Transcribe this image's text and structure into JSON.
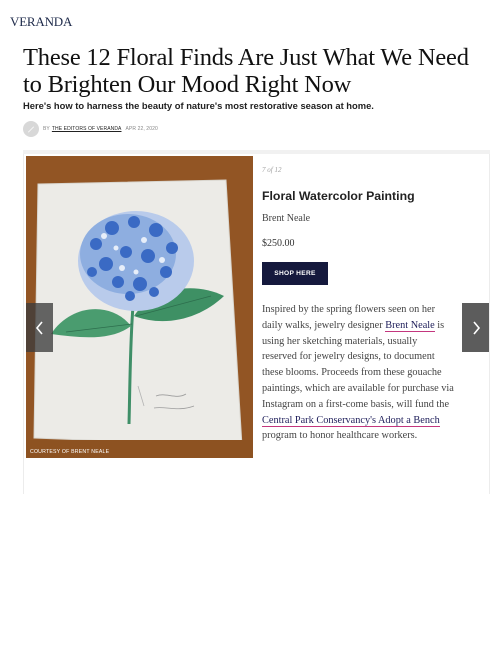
{
  "site": {
    "logo": "VERANDA"
  },
  "article": {
    "headline": "These 12 Floral Finds Are Just What We Need to Brighten Our Mood Right Now",
    "dek": "Here's how to harness the beauty of nature's most restorative season at home.",
    "byline_prefix": "BY",
    "author": "THE EDITORS OF VERANDA",
    "date": "APR 22, 2020"
  },
  "slide": {
    "counter": "7 of 12",
    "title": "Floral Watercolor Painting",
    "brand": "Brent Neale",
    "price": "$250.00",
    "cta": "SHOP HERE",
    "credit": "COURTESY OF BRENT NEALE",
    "desc_1": "Inspired by the spring flowers seen on her daily walks, jewelry designer ",
    "link_1": "Brent Neale",
    "desc_2": " is using her sketching materials, usually reserved for jewelry designs, to document these blooms. Proceeds from these gouache paintings, which are available for purchase via Instagram on a first-come basis, will fund the ",
    "link_2": "Central Park Conservancy's Adopt a Bench",
    "desc_3": " program to honor healthcare workers."
  },
  "icons": {
    "prev": "chevron-left-icon",
    "next": "chevron-right-icon",
    "avatar": "pen-icon"
  },
  "colors": {
    "button": "#15193d",
    "link_underline": "#c3367e",
    "logo": "#1e2a4a"
  }
}
